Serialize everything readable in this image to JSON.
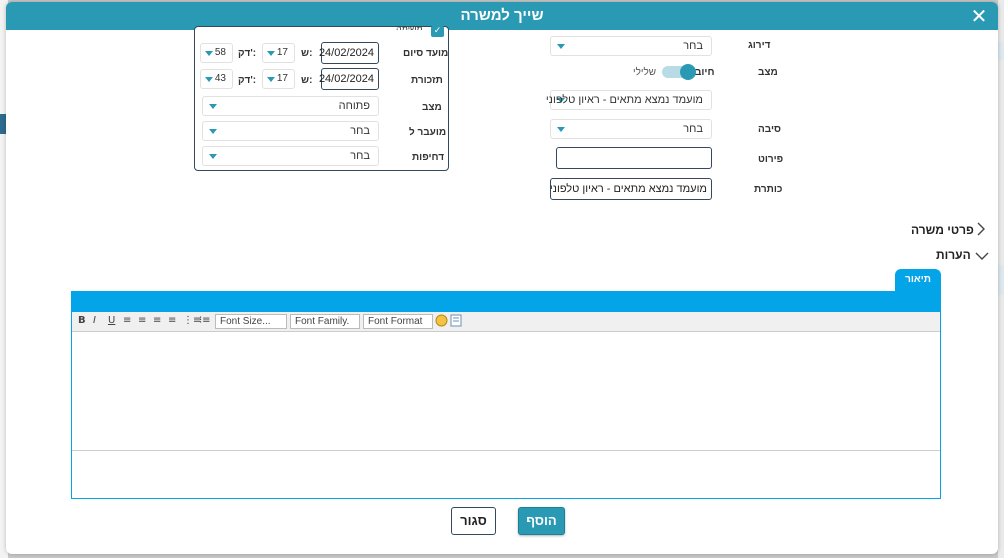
{
  "modal": {
    "title": "שייך למשרה"
  },
  "form": {
    "rank": {
      "label": "דירוג",
      "value": "בחר"
    },
    "status": {
      "label": "מצב",
      "positive": "חיובי",
      "negative": "שלילי",
      "toggle_on": true
    },
    "status_select": {
      "value": "מועמד נמצא מתאים - ראיון טלפוני"
    },
    "reason": {
      "label": "סיבה",
      "value": "בחר"
    },
    "details": {
      "label": "פירוט",
      "value": ""
    },
    "subject": {
      "label": "כותרת",
      "value": "מועמד נמצא מתאים - ראיון טלפוני - בר"
    }
  },
  "task": {
    "checked": true,
    "checkbox_label": "משימה",
    "due": {
      "label": "מועד סיום",
      "date": "24/02/2024",
      "hour_label": "ש:",
      "hour": "17",
      "min_label": "דק':",
      "min": "58"
    },
    "reminder": {
      "label": "תזכורת",
      "date": "24/02/2024",
      "hour_label": "ש:",
      "hour": "17",
      "min_label": "דק':",
      "min": "43"
    },
    "state": {
      "label": "מצב",
      "value": "פתוחה"
    },
    "assigned": {
      "label": "מועבר ל",
      "value": "בחר"
    },
    "urgency": {
      "label": "דחיפות",
      "value": "בחר"
    }
  },
  "sections": {
    "job_details": "פרטי משרה",
    "notes": "הערות"
  },
  "editor": {
    "tab": "תיאור",
    "bold": "B",
    "italic": "I",
    "underline": "U",
    "font_size": "Font Size...",
    "font_family": "Font Family.",
    "font_format": "Font Format"
  },
  "buttons": {
    "add": "הוסף",
    "close": "סגור"
  },
  "colors": {
    "header": "#2a9ab4",
    "editor_accent": "#03a5e8"
  }
}
